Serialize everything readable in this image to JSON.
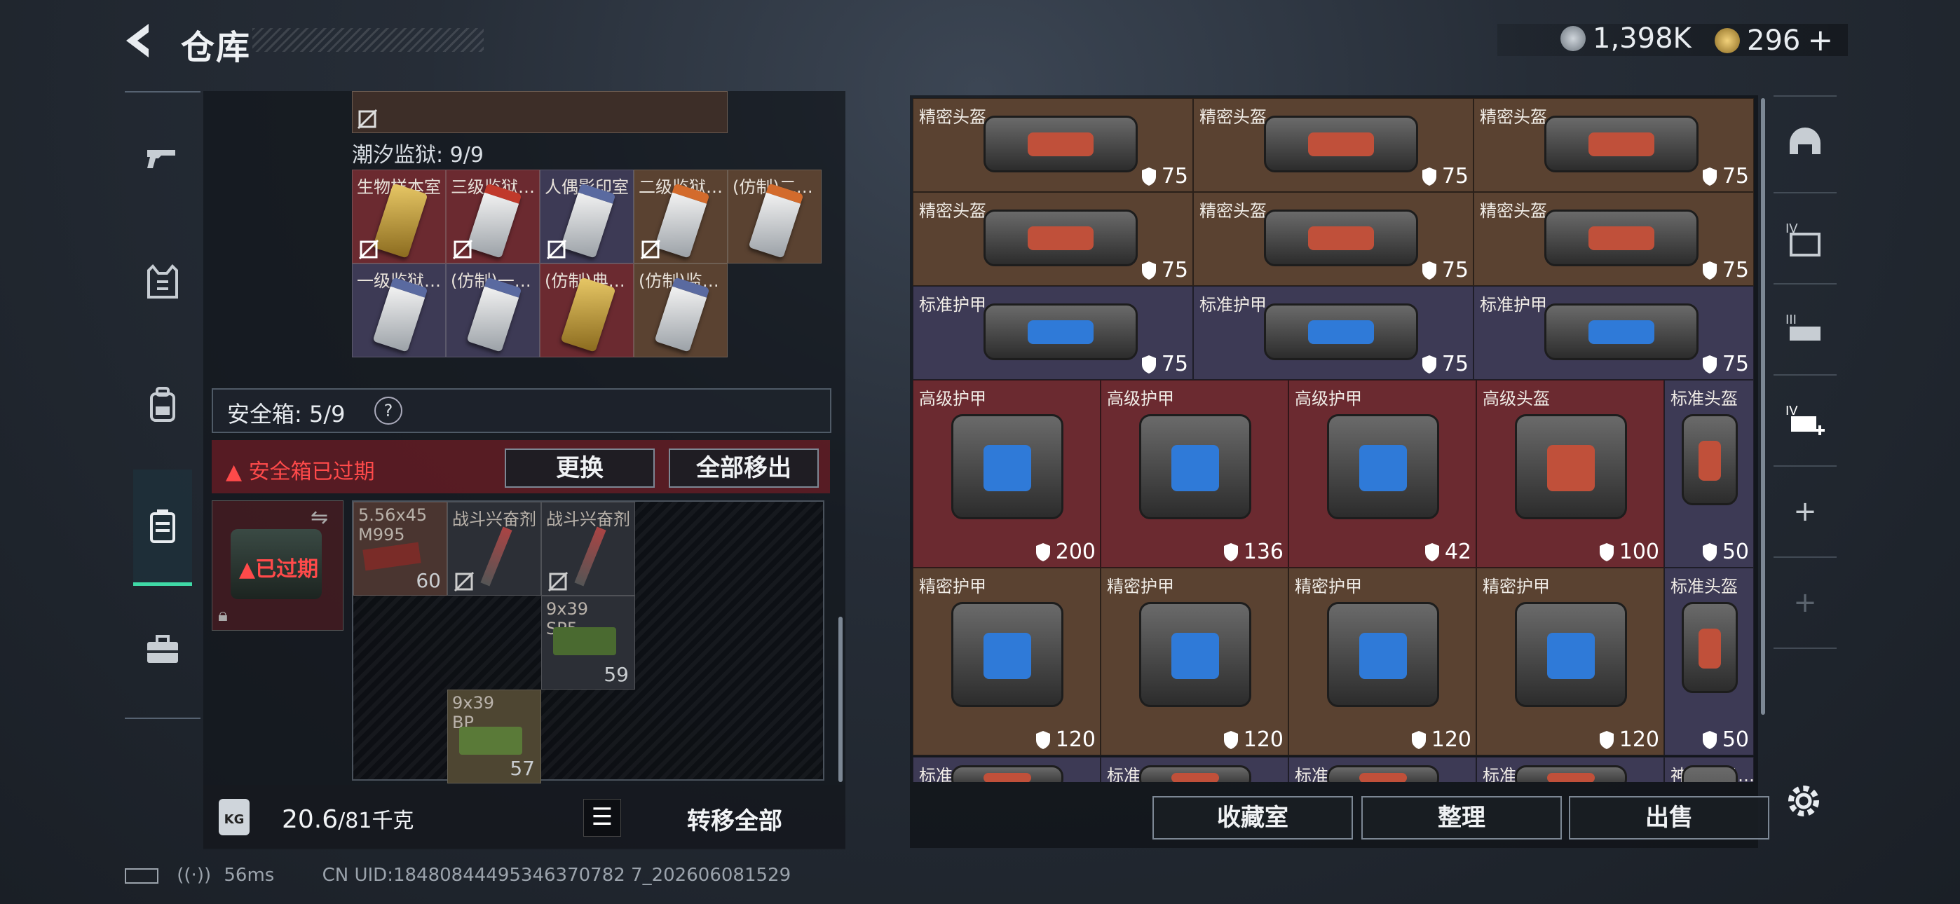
{
  "header": {
    "title": "仓库",
    "currency_silver": "1,398K",
    "currency_gold": "296",
    "add_label": "+"
  },
  "left_nav": {
    "items": [
      "weapons-icon",
      "vest-icon",
      "backpack-icon",
      "safe-case-icon",
      "toolbox-icon"
    ]
  },
  "top_cards": {
    "section_title": "潮汐监狱: 9/9",
    "row1": [
      "生物样本室",
      "三级监狱…",
      "人偶影印室",
      "二级监狱…",
      "(仿制)二…"
    ],
    "row2": [
      "一级监狱…",
      "(仿制)一…",
      "(仿制)典…",
      "(仿制)监…"
    ]
  },
  "safe_box": {
    "label": "安全箱: 5/9",
    "help": "?",
    "expired_msg": "安全箱已过期",
    "replace_btn": "更换",
    "move_all_btn": "全部移出",
    "case_status": "已过期"
  },
  "safe_items": [
    {
      "name": "5.56x45 M995",
      "qty": "60"
    },
    {
      "name": "战斗兴奋剂",
      "qty": ""
    },
    {
      "name": "战斗兴奋剂",
      "qty": ""
    },
    {
      "name": "9x39 SP5",
      "qty": "59"
    },
    {
      "name": "9x39 BP",
      "qty": "57"
    }
  ],
  "weight": {
    "current": "20.6",
    "max": "/81千克",
    "transfer_all": "转移全部"
  },
  "storage": {
    "rows": [
      [
        {
          "name": "精密头盔",
          "dur": "75"
        },
        {
          "name": "精密头盔",
          "dur": "75"
        },
        {
          "name": "精密头盔",
          "dur": "75"
        }
      ],
      [
        {
          "name": "精密头盔",
          "dur": "75"
        },
        {
          "name": "精密头盔",
          "dur": "75"
        },
        {
          "name": "精密头盔",
          "dur": "75"
        }
      ],
      [
        {
          "name": "标准护甲",
          "dur": "75"
        },
        {
          "name": "标准护甲",
          "dur": "75"
        },
        {
          "name": "标准护甲",
          "dur": "75"
        }
      ],
      [
        {
          "name": "高级护甲",
          "dur": "200"
        },
        {
          "name": "高级护甲",
          "dur": "136"
        },
        {
          "name": "高级护甲",
          "dur": "42"
        },
        {
          "name": "高级头盔",
          "dur": "100"
        },
        {
          "name": "标准头盔",
          "dur": "50"
        }
      ],
      [
        {
          "name": "精密护甲",
          "dur": "120"
        },
        {
          "name": "精密护甲",
          "dur": "120"
        },
        {
          "name": "精密护甲",
          "dur": "120"
        },
        {
          "name": "精密护甲",
          "dur": "120"
        },
        {
          "name": "标准头盔",
          "dur": "50"
        }
      ],
      [
        {
          "name": "标准头盔"
        },
        {
          "name": "标准头盔"
        },
        {
          "name": "标准头盔"
        },
        {
          "name": "标准头盔"
        },
        {
          "name": "神秘脑机…"
        }
      ]
    ],
    "collect_btn": "收藏室",
    "sort_btn": "整理",
    "sell_btn": "出售"
  },
  "right_nav": {
    "items": [
      "armor-icon",
      "tier-iv-icon",
      "tier-iii-icon",
      "tier-iv-add-icon"
    ],
    "add_label": "+"
  },
  "footer": {
    "ping": "56ms",
    "uid": "CN UID:18480844495346370782 7_202606081529"
  },
  "colors": {
    "accent": "#3fd9a6",
    "danger": "#ff4a4a",
    "brown_cell": "#5a4231",
    "purple_cell": "#3d3a55",
    "red_cell": "#6b2a30"
  }
}
